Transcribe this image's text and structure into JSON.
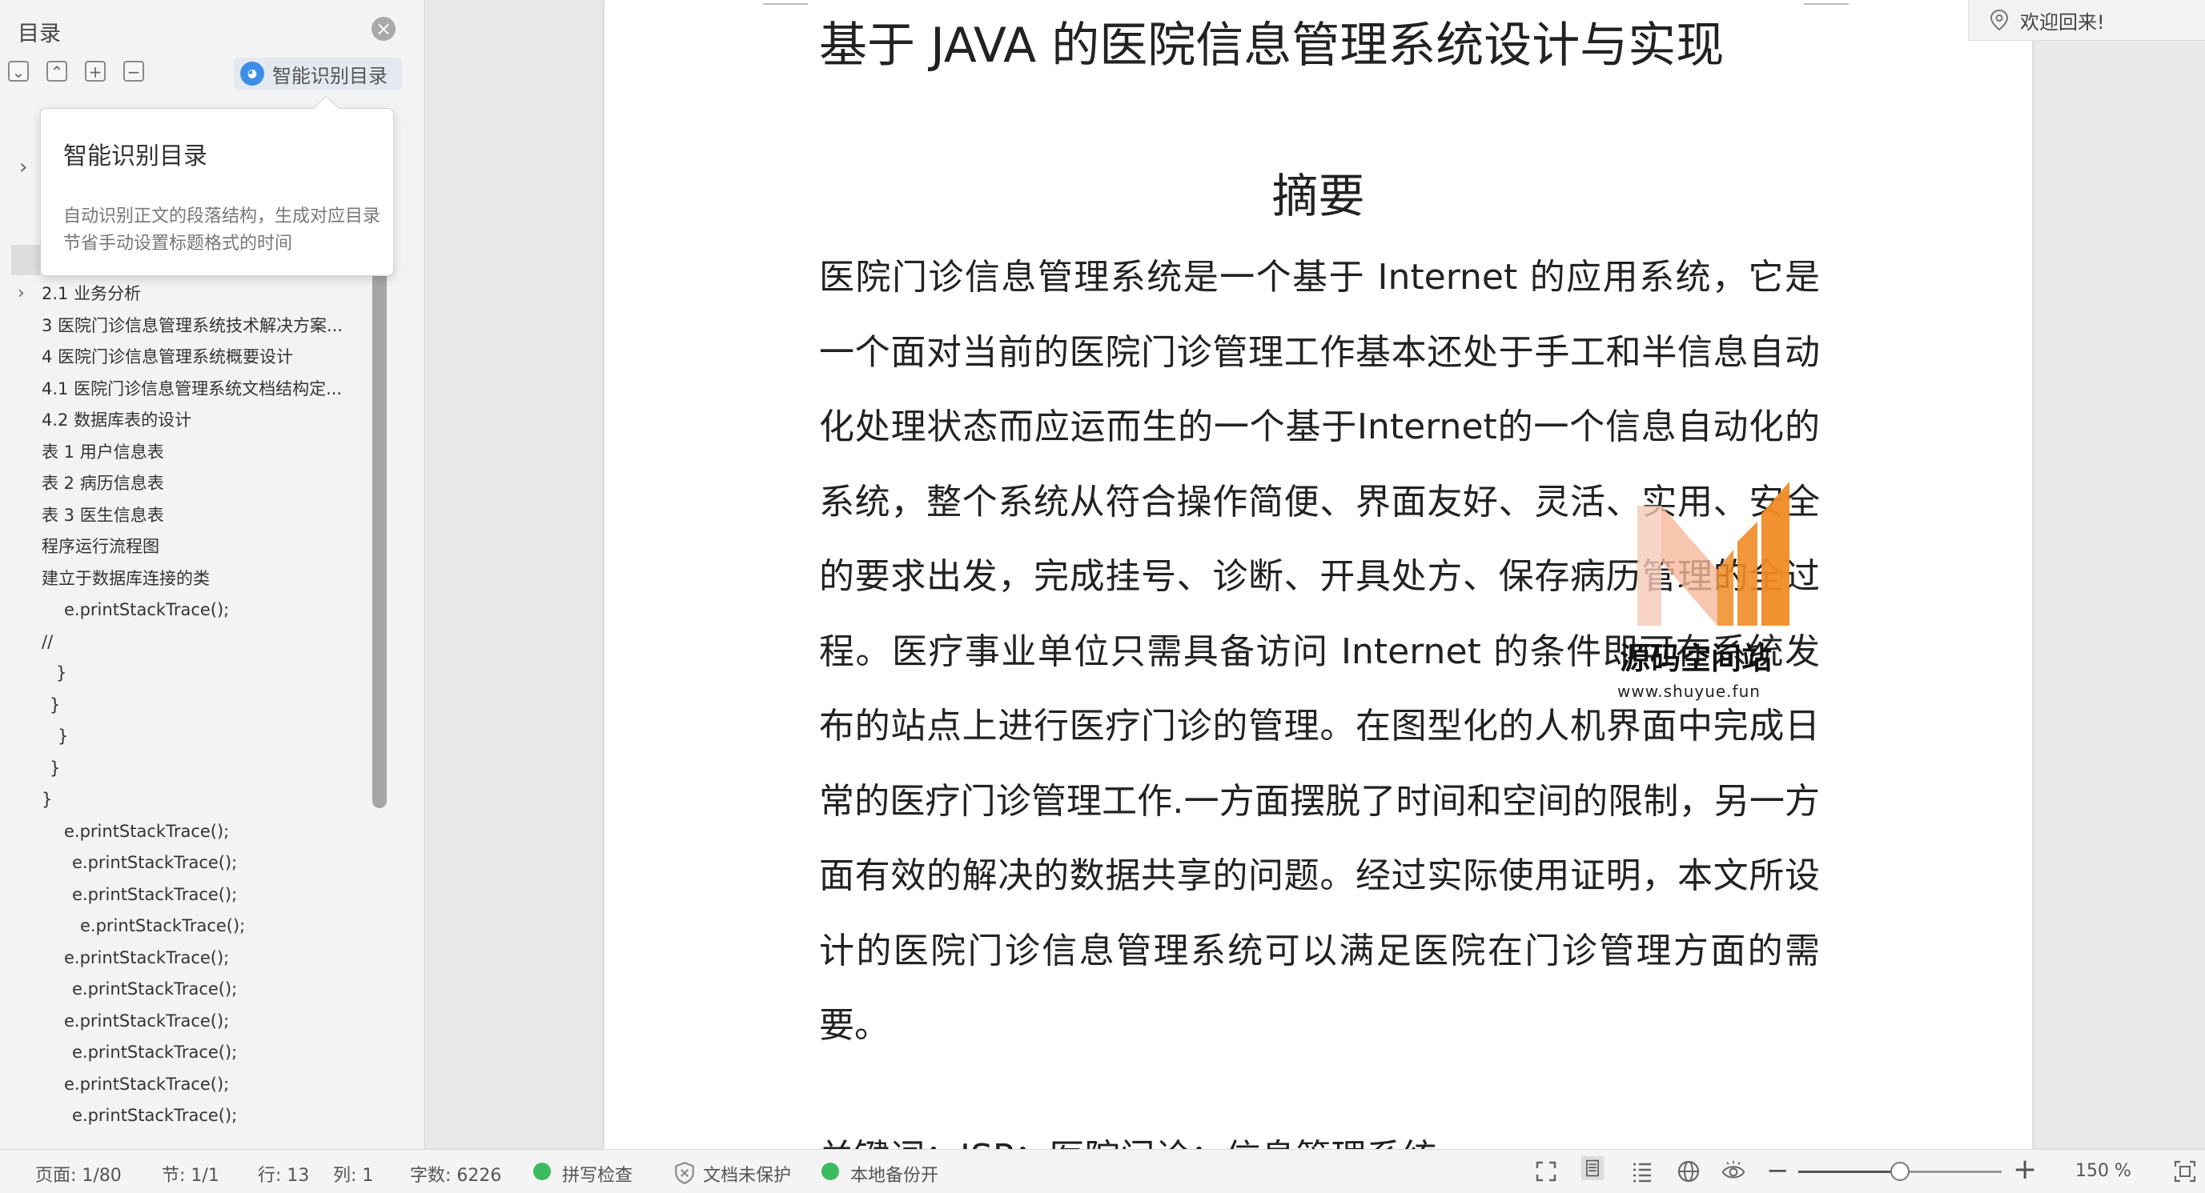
{
  "sidebar": {
    "title": "目录",
    "smart_toc_button": "智能识别目录",
    "tooltip": {
      "title": "智能识别目录",
      "description": "自动识别正文的段落结构，生成对应目录节省手动设置标题格式的时间"
    },
    "toc_items": [
      {
        "label": "2.1 业务分析",
        "has_children": true
      },
      {
        "label": "3 医院门诊信息管理系统技术解决方案..."
      },
      {
        "label": "4 医院门诊信息管理系统概要设计"
      },
      {
        "label": "4.1 医院门诊信息管理系统文档结构定..."
      },
      {
        "label": "4.2  数据库表的设计"
      },
      {
        "label": "表 1 用户信息表"
      },
      {
        "label": "表 2 病历信息表"
      },
      {
        "label": "表 3 医生信息表"
      },
      {
        "label": "程序运行流程图"
      },
      {
        "label": "建立于数据库连接的类"
      },
      {
        "label": "e.printStackTrace();"
      },
      {
        "label": "//"
      },
      {
        "label": "}"
      },
      {
        "label": "}"
      },
      {
        "label": "}"
      },
      {
        "label": "}"
      },
      {
        "label": "}"
      },
      {
        "label": "e.printStackTrace();"
      },
      {
        "label": "e.printStackTrace();"
      },
      {
        "label": "e.printStackTrace();"
      },
      {
        "label": "e.printStackTrace();"
      },
      {
        "label": "e.printStackTrace();"
      },
      {
        "label": "e.printStackTrace();"
      },
      {
        "label": "e.printStackTrace();"
      },
      {
        "label": "e.printStackTrace();"
      },
      {
        "label": "e.printStackTrace();"
      },
      {
        "label": "e.printStackTrace();"
      }
    ]
  },
  "document": {
    "title": "基于 JAVA 的医院信息管理系统设计与实现",
    "abstract_heading": "摘要",
    "abstract_body": "医院门诊信息管理系统是一个基于 Internet 的应用系统，它是一个面对当前的医院门诊管理工作基本还处于手工和半信息自动化处理状态而应运而生的一个基于Internet的一个信息自动化的系统，整个系统从符合操作简便、界面友好、灵活、实用、安全的要求出发，完成挂号、诊断、开具处方、保存病历管理的全过程。医疗事业单位只需具备访问 Internet 的条件即可在系统发布的站点上进行医疗门诊的管理。在图型化的人机界面中完成日常的医疗门诊管理工作.一方面摆脱了时间和空间的限制，另一方面有效的解决的数据共享的问题。经过实际使用证明，本文所设计的医院门诊信息管理系统可以满足医院在门诊管理方面的需要。",
    "keywords_line": "关键词：JSP；医院门诊；信息管理系统",
    "watermark_name": "源码空间站",
    "watermark_url": "www.shuyue.fun"
  },
  "welcome": "欢迎回来!",
  "statusbar": {
    "page": "页面: 1/80",
    "section": "节: 1/1",
    "row": "行: 13",
    "col": "列: 1",
    "word_count": "字数: 6226",
    "spellcheck": "拼写检查",
    "protection": "文档未保护",
    "backup": "本地备份开",
    "zoom": "150 %",
    "zoom_level": 0.5
  },
  "colors": {
    "accent_green": "#3dbb5f",
    "accent_blue": "#3e8ee8",
    "watermark_orange": "#f08b25"
  }
}
